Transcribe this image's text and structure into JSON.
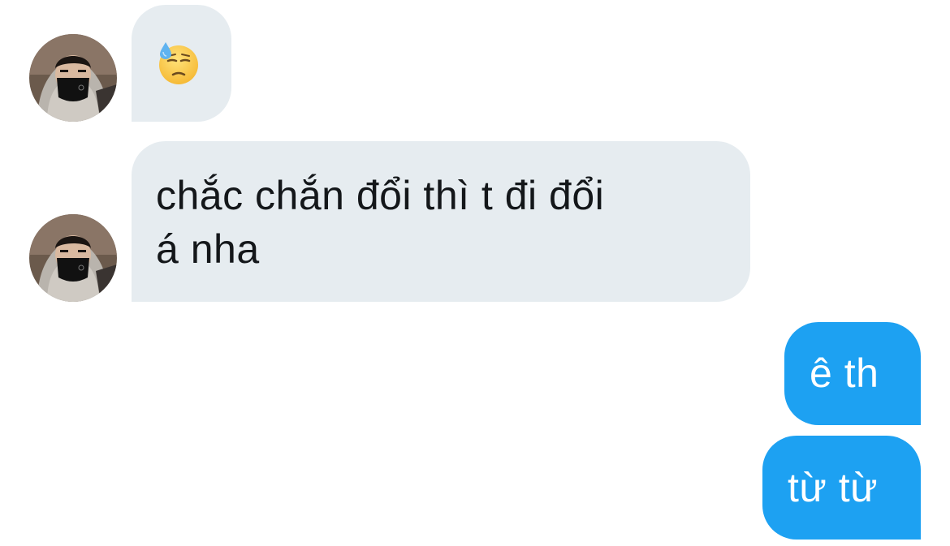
{
  "conversation": {
    "messages": [
      {
        "from": "them",
        "kind": "emoji",
        "emoji_icon": "downcast-face-with-sweat-icon"
      },
      {
        "from": "them",
        "kind": "text",
        "text": "chắc chắn đổi thì t đi đổi\ná nha"
      },
      {
        "from": "me",
        "kind": "text",
        "text": "ê th"
      },
      {
        "from": "me",
        "kind": "text",
        "text": "từ từ"
      }
    ]
  },
  "colors": {
    "incoming_bubble": "#e6ecf0",
    "outgoing_bubble": "#1da1f2",
    "incoming_text": "#14171a",
    "outgoing_text": "#ffffff"
  }
}
